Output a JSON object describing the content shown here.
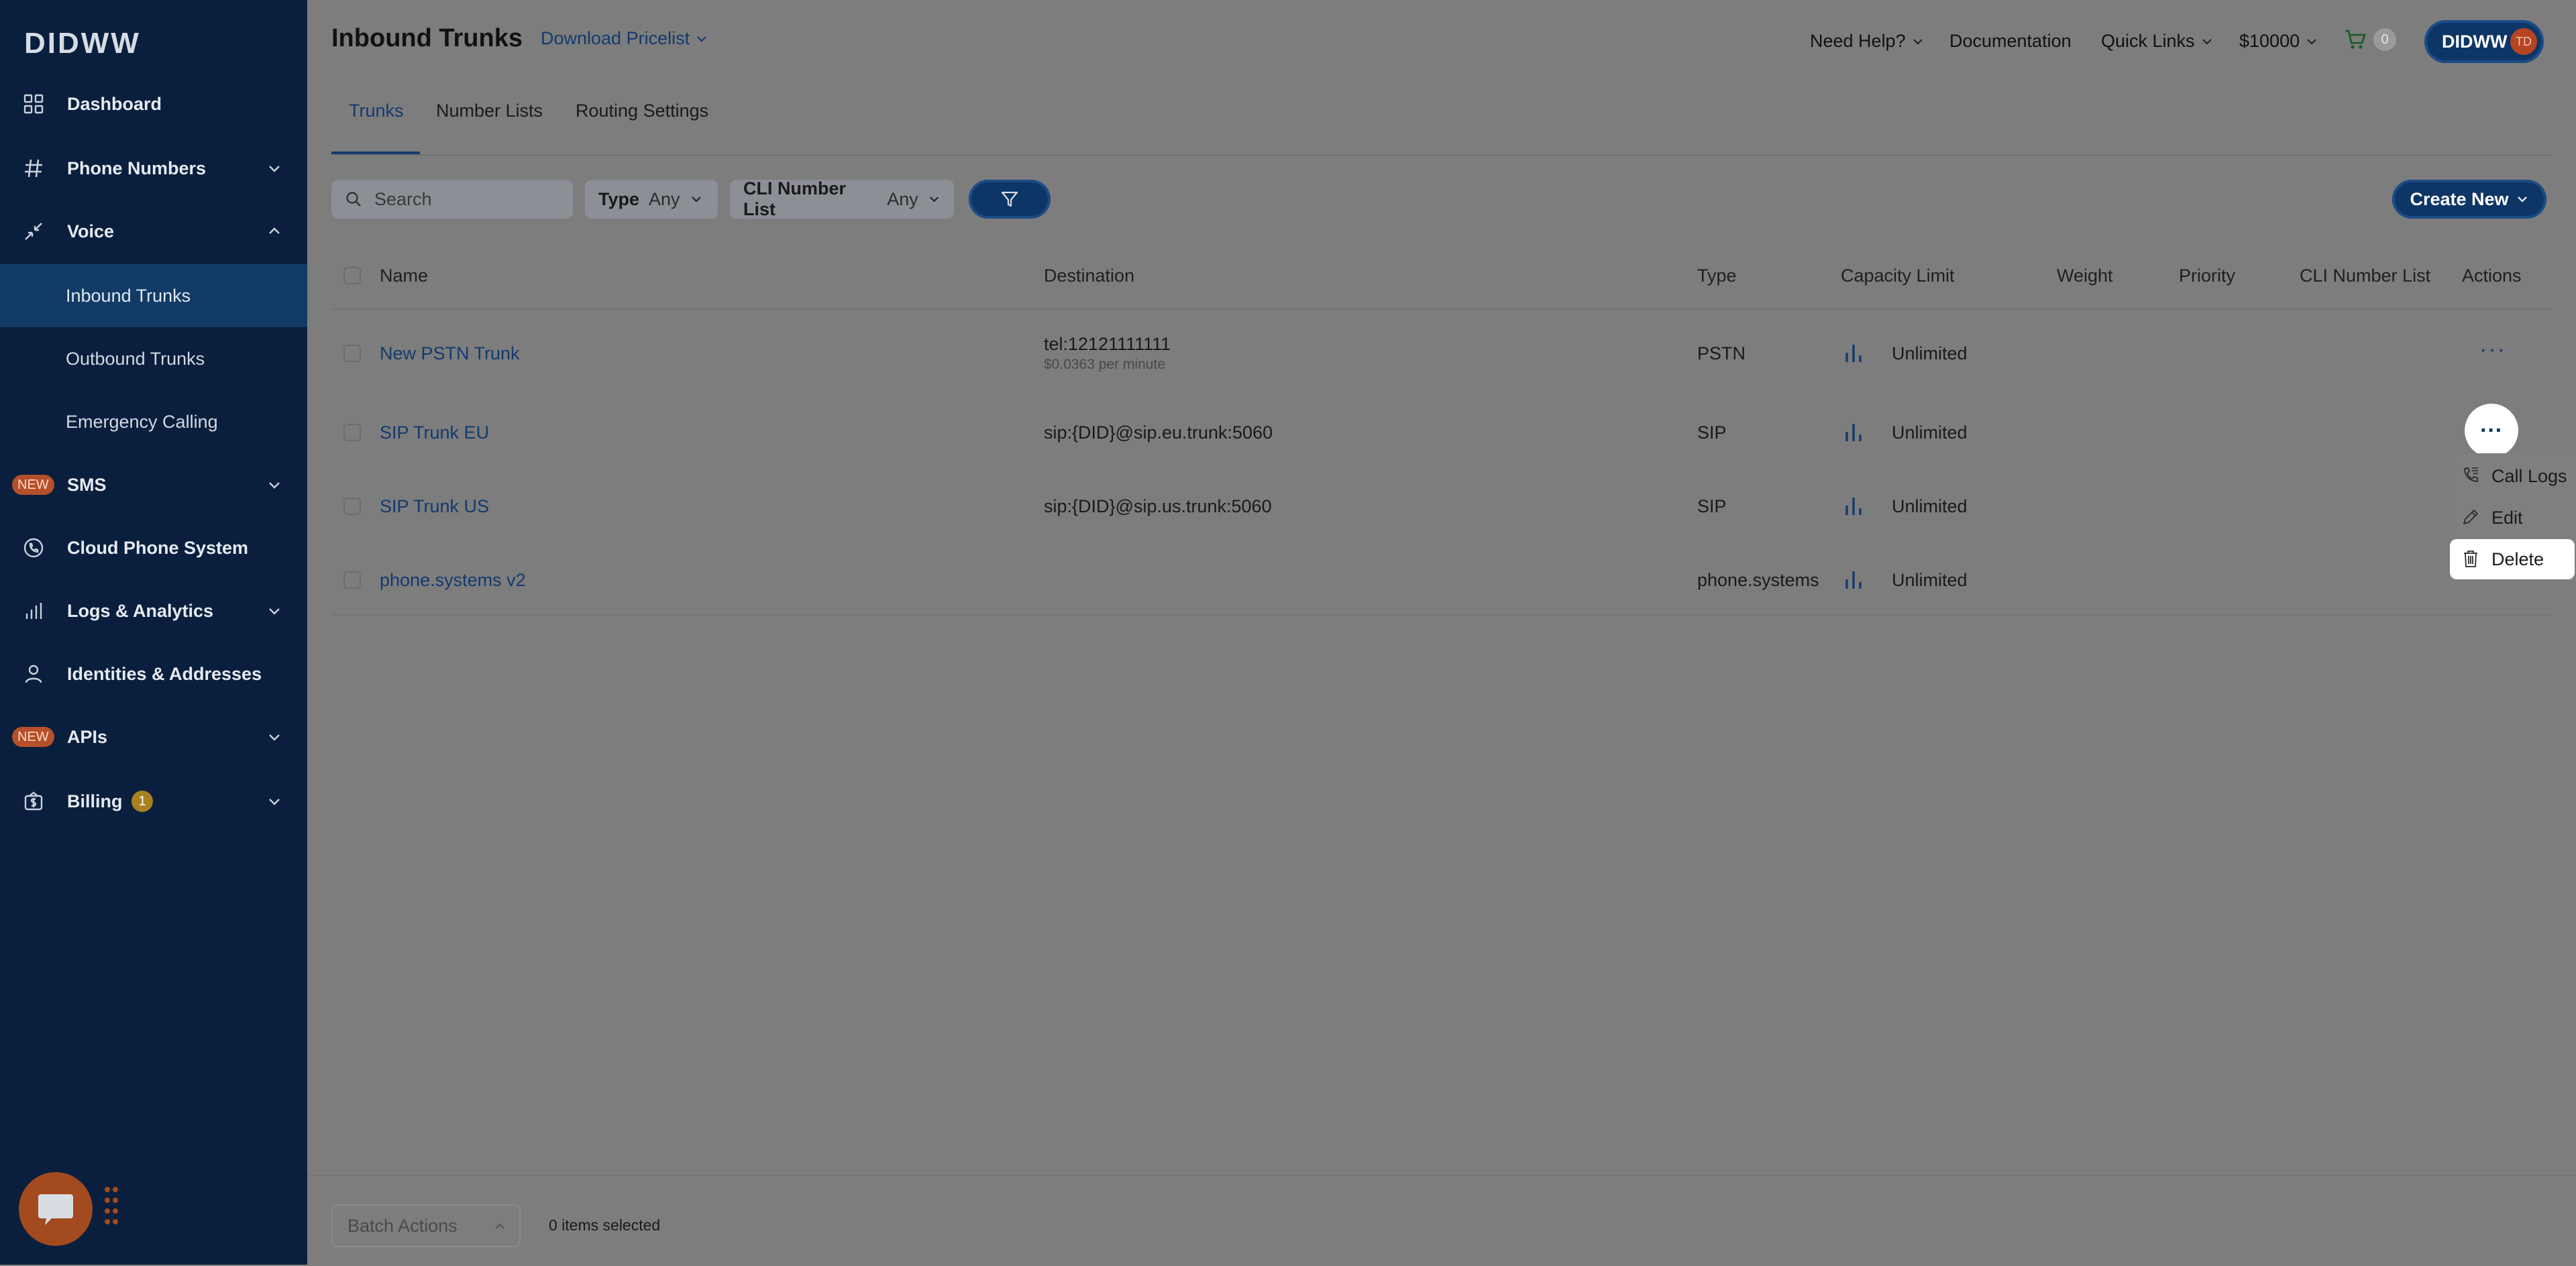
{
  "brand": {
    "logo": "DIDWW"
  },
  "sidebar": {
    "items": [
      {
        "label": "Dashboard",
        "icon": "dashboard-grid-icon"
      },
      {
        "label": "Phone Numbers",
        "icon": "hash-icon",
        "expandable": true
      },
      {
        "label": "Voice",
        "icon": "voice-arrows-icon",
        "expanded": true
      },
      {
        "label": "Inbound Trunks",
        "sub": true,
        "active": true
      },
      {
        "label": "Outbound Trunks",
        "sub": true
      },
      {
        "label": "Emergency Calling",
        "sub": true
      },
      {
        "label": "SMS",
        "badge": "NEW",
        "expandable": true
      },
      {
        "label": "Cloud Phone System",
        "icon": "phone-circle-icon"
      },
      {
        "label": "Logs & Analytics",
        "icon": "bar-chart-icon",
        "expandable": true
      },
      {
        "label": "Identities & Addresses",
        "icon": "person-icon"
      },
      {
        "label": "APIs",
        "badge": "NEW",
        "expandable": true
      },
      {
        "label": "Billing",
        "icon": "billing-icon",
        "count": "1",
        "expandable": true
      }
    ]
  },
  "header": {
    "title": "Inbound Trunks",
    "download_pricelist": "Download Pricelist",
    "need_help": "Need Help?",
    "documentation": "Documentation",
    "quick_links": "Quick Links",
    "balance": "$10000",
    "cart_count": "0",
    "account_label": "DIDWW",
    "avatar_initials": "TD"
  },
  "tabs": [
    {
      "label": "Trunks",
      "active": true
    },
    {
      "label": "Number Lists"
    },
    {
      "label": "Routing Settings"
    }
  ],
  "filters": {
    "search_placeholder": "Search",
    "type_label": "Type",
    "type_value": "Any",
    "cli_label": "CLI Number List",
    "cli_value": "Any",
    "create_new": "Create New"
  },
  "table": {
    "columns": [
      "Name",
      "Destination",
      "Type",
      "Capacity Limit",
      "Weight",
      "Priority",
      "CLI Number List",
      "Actions"
    ],
    "rows": [
      {
        "name": "New PSTN Trunk",
        "destination": "tel:12121111111",
        "destination_sub": "$0.0363 per minute",
        "type": "PSTN",
        "capacity": "Unlimited"
      },
      {
        "name": "SIP Trunk EU",
        "destination": "sip:{DID}@sip.eu.trunk:5060",
        "destination_sub": "",
        "type": "SIP",
        "capacity": "Unlimited"
      },
      {
        "name": "SIP Trunk US",
        "destination": "sip:{DID}@sip.us.trunk:5060",
        "destination_sub": "",
        "type": "SIP",
        "capacity": "Unlimited"
      },
      {
        "name": "phone.systems v2",
        "destination": "",
        "destination_sub": "",
        "type": "phone.systems",
        "capacity": "Unlimited"
      }
    ],
    "actions_glyph": "···"
  },
  "row_menu": {
    "items": [
      {
        "label": "Call Logs",
        "icon": "call-logs-icon"
      },
      {
        "label": "Edit",
        "icon": "pencil-icon"
      },
      {
        "label": "Delete",
        "icon": "trash-icon",
        "highlighted": true
      }
    ]
  },
  "footer": {
    "batch_actions": "Batch Actions",
    "items_selected": "0 items selected"
  },
  "colors": {
    "sidebar_bg": "#0a1f3d",
    "sidebar_active": "#123a66",
    "accent": "#143a6e",
    "overlay_bg": "#7d7d7d",
    "badge_new": "#b5502a"
  }
}
